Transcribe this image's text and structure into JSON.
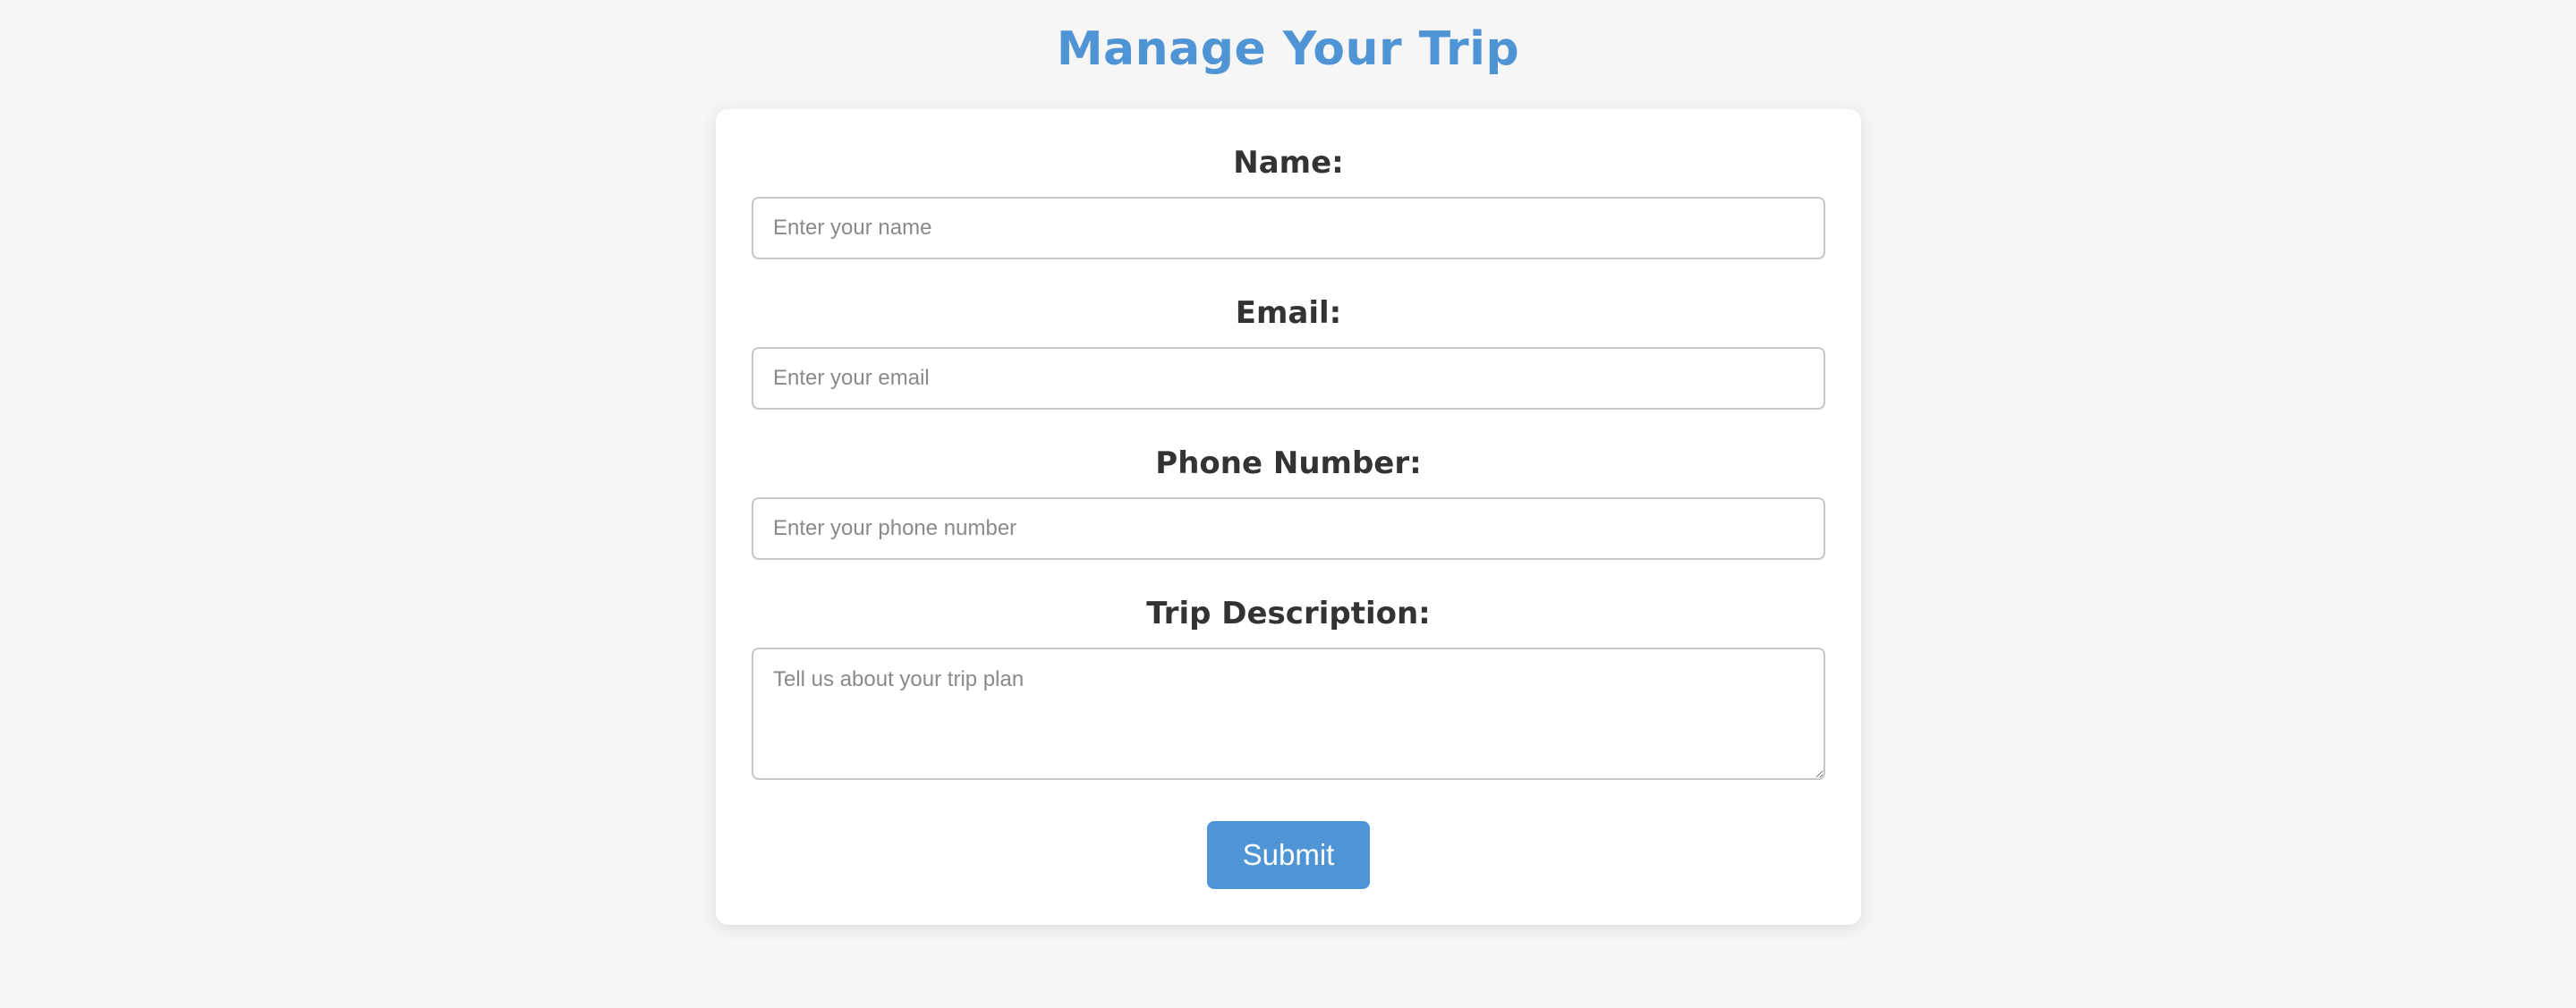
{
  "page": {
    "title": "Manage Your Trip"
  },
  "form": {
    "name": {
      "label": "Name:",
      "placeholder": "Enter your name",
      "value": ""
    },
    "email": {
      "label": "Email:",
      "placeholder": "Enter your email",
      "value": ""
    },
    "phone": {
      "label": "Phone Number:",
      "placeholder": "Enter your phone number",
      "value": ""
    },
    "trip_description": {
      "label": "Trip Description:",
      "placeholder": "Tell us about your trip plan",
      "value": ""
    },
    "submit_label": "Submit"
  },
  "colors": {
    "accent": "#4f94d4",
    "background": "#f6f6f6",
    "card": "#ffffff",
    "label_text": "#333333"
  }
}
